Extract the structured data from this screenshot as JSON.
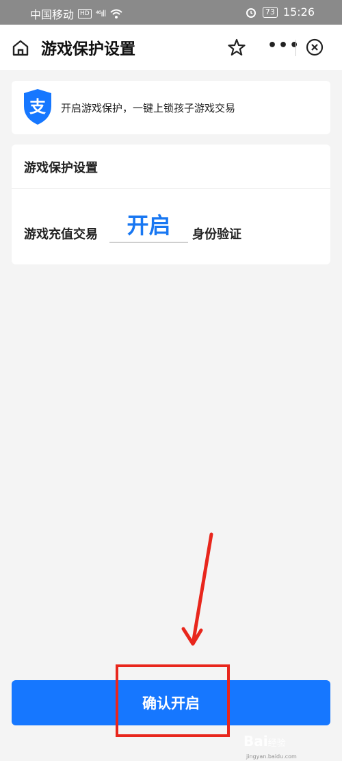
{
  "status_bar": {
    "carrier": "中国移动",
    "hd": "HD",
    "signal": "⁴⁶ıll",
    "battery": "73",
    "time": "15:26"
  },
  "nav": {
    "title": "游戏保护设置",
    "icons": [
      "home-icon",
      "star-icon",
      "more-icon",
      "close-icon"
    ],
    "more_label": "•••"
  },
  "banner": {
    "logo_char": "支",
    "text": "开启游戏保护，一键上锁孩子游戏交易"
  },
  "card": {
    "heading": "游戏保护设置",
    "row_label": "游戏充值交易",
    "blank_value": "开启",
    "row_suffix": "身份验证"
  },
  "confirm_button": {
    "label": "确认开启"
  },
  "watermark": {
    "brand": "Bai",
    "brand2": "经验",
    "url": "jingyan.baidu.com"
  },
  "colors": {
    "accent": "#1677ff",
    "annotation": "#e8261c",
    "status_bar": "#8a8a8a"
  }
}
